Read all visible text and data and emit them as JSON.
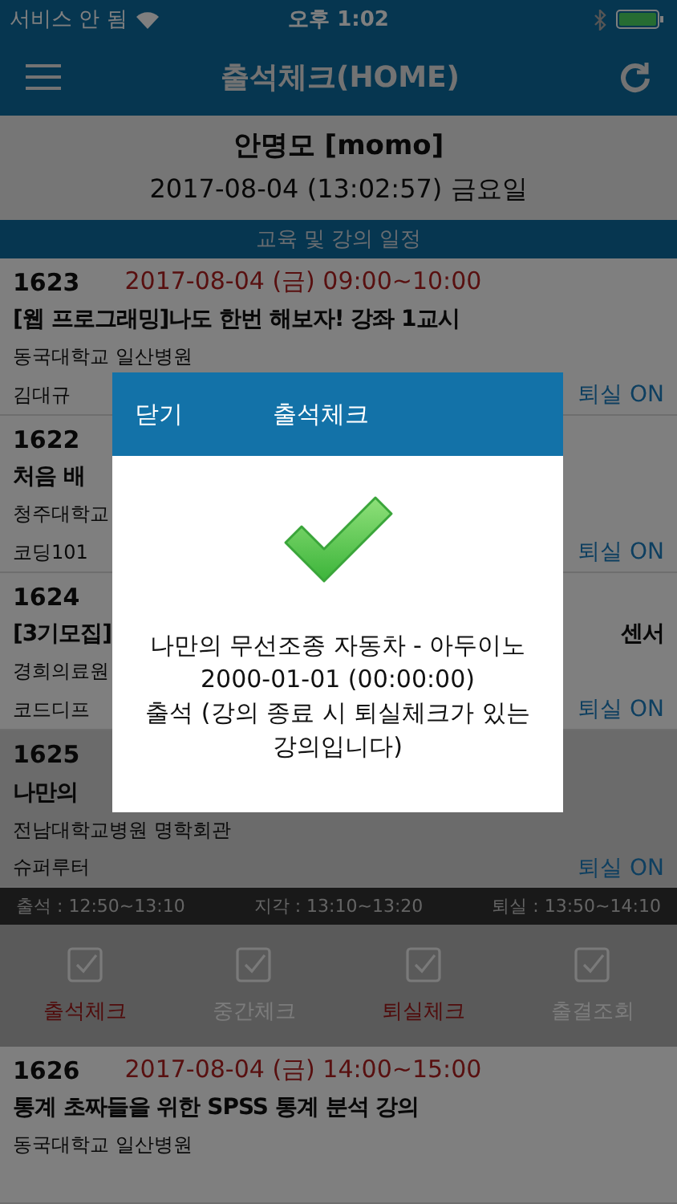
{
  "status_bar": {
    "carrier": "서비스 안 됨",
    "time": "오후 1:02"
  },
  "nav": {
    "title": "출석체크(HOME)"
  },
  "user": {
    "name": "안명모 [momo]",
    "datetime": "2017-08-04 (13:02:57) 금요일"
  },
  "section_title": "교육 및 강의 일정",
  "rows": [
    {
      "id": "1623",
      "date": "2017-08-04 (금) 09:00~10:00",
      "title": "[웹 프로그래밍]나도 한번 해보자! 강좌 1교시",
      "location": "동국대학교 일산병원",
      "instructor": "김대규",
      "exit_label": "퇴실 ON",
      "selected": false
    },
    {
      "id": "1622",
      "title": "처음 배",
      "location": "청주대학교",
      "instructor": "코딩101",
      "exit_label": "퇴실 ON",
      "selected": false
    },
    {
      "id": "1624",
      "title": "[3기모집]",
      "title_right": "센서",
      "location": "경희의료원",
      "instructor": "코드디프",
      "exit_label": "퇴실 ON",
      "selected": false
    },
    {
      "id": "1625",
      "title": "나만의",
      "location": "전남대학교병원 명학회관",
      "instructor": "슈퍼루터",
      "exit_label": "퇴실 ON",
      "selected": true
    }
  ],
  "time_bar": [
    "출석 : 12:50~13:10",
    "지각 : 13:10~13:20",
    "퇴실 : 13:50~14:10"
  ],
  "actions": [
    {
      "label": "출석체크",
      "disabled": false
    },
    {
      "label": "중간체크",
      "disabled": true
    },
    {
      "label": "퇴실체크",
      "disabled": false
    },
    {
      "label": "출결조회",
      "disabled": true
    }
  ],
  "next_row": {
    "id": "1626",
    "date": "2017-08-04 (금) 14:00~15:00",
    "title": "통계 초짜들을 위한 SPSS 통계 분석 강의",
    "location": "동국대학교 일산병원"
  },
  "modal": {
    "close": "닫기",
    "title": "출석체크",
    "lecture": "나만의 무선조종 자동차 - 아두이노",
    "datetime": "2000-01-01 (00:00:00)",
    "message": "출석 (강의 종료 시 퇴실체크가 있는 강의입니다)"
  }
}
